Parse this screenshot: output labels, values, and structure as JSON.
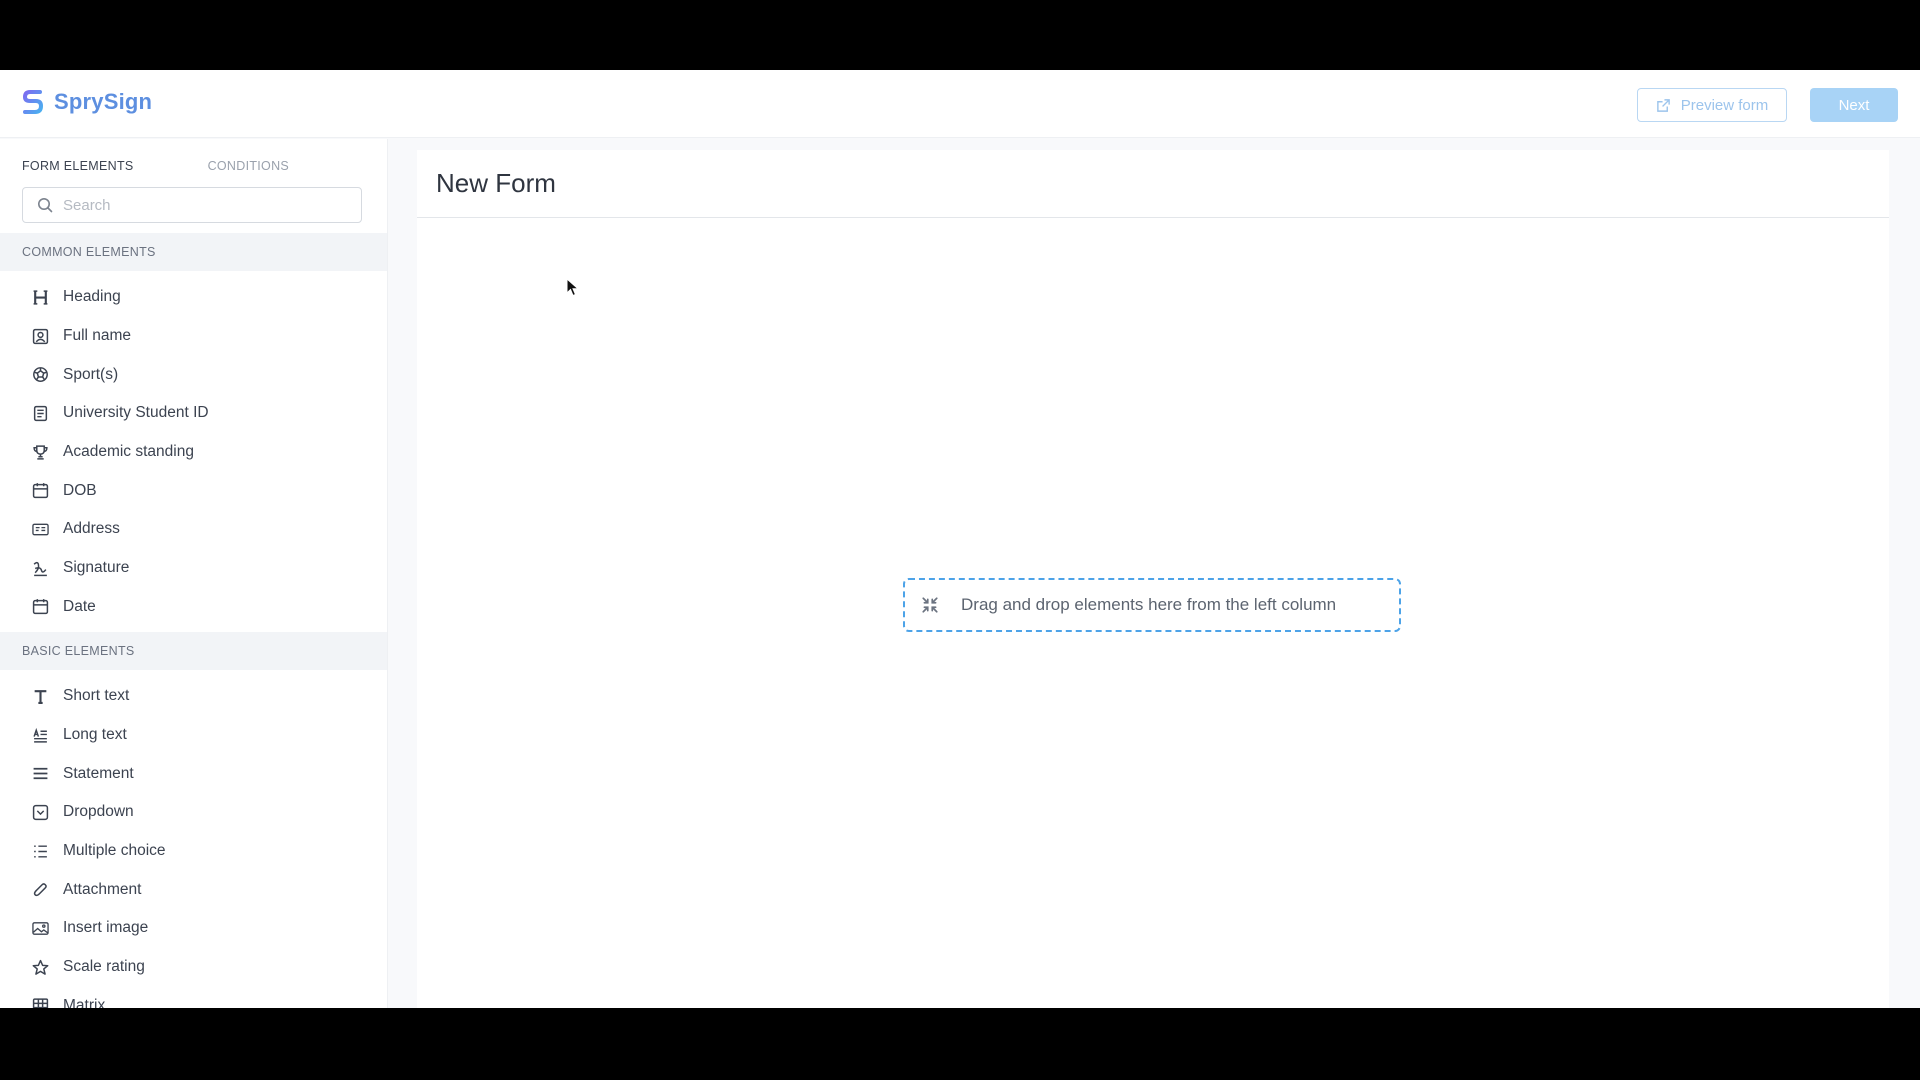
{
  "brand": {
    "name": "SprySign"
  },
  "topbar": {
    "preview_label": "Preview form",
    "next_label": "Next"
  },
  "sidebar": {
    "tabs": [
      {
        "label": "FORM ELEMENTS"
      },
      {
        "label": "CONDITIONS"
      }
    ],
    "search": {
      "placeholder": "Search"
    },
    "common": {
      "header": "COMMON ELEMENTS",
      "items": [
        {
          "label": "Heading",
          "icon": "heading-icon"
        },
        {
          "label": "Full name",
          "icon": "user-card-icon"
        },
        {
          "label": "Sport(s)",
          "icon": "ball-icon"
        },
        {
          "label": "University Student ID",
          "icon": "id-document-icon"
        },
        {
          "label": "Academic standing",
          "icon": "trophy-icon"
        },
        {
          "label": "DOB",
          "icon": "calendar-icon"
        },
        {
          "label": "Address",
          "icon": "address-card-icon"
        },
        {
          "label": "Signature",
          "icon": "signature-icon"
        },
        {
          "label": "Date",
          "icon": "calendar-icon"
        }
      ]
    },
    "basic": {
      "header": "BASIC ELEMENTS",
      "items": [
        {
          "label": "Short text",
          "icon": "text-icon"
        },
        {
          "label": "Long text",
          "icon": "long-text-icon"
        },
        {
          "label": "Statement",
          "icon": "statement-icon"
        },
        {
          "label": "Dropdown",
          "icon": "dropdown-icon"
        },
        {
          "label": "Multiple choice",
          "icon": "list-icon"
        },
        {
          "label": "Attachment",
          "icon": "paperclip-icon"
        },
        {
          "label": "Insert image",
          "icon": "image-icon"
        },
        {
          "label": "Scale rating",
          "icon": "star-icon"
        },
        {
          "label": "Matrix",
          "icon": "grid-icon"
        }
      ]
    }
  },
  "canvas": {
    "title": "New Form",
    "dropzone_text": "Drag and drop elements here from the left column"
  },
  "colors": {
    "accent": "#4da3e8",
    "brand": "#5d8fe0"
  }
}
